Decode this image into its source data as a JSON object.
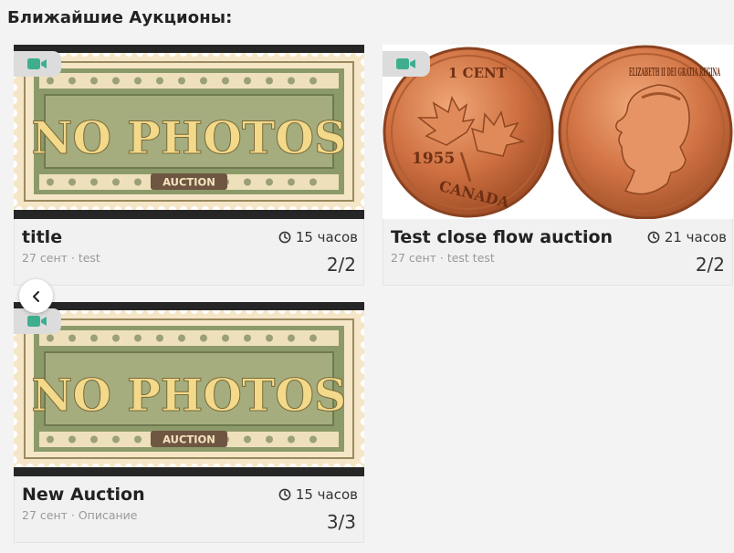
{
  "section": {
    "title": "Ближайшие Аукционы:"
  },
  "colors": {
    "camera_icon": "#3fae8f",
    "badge_bg": "#dcdcdc",
    "stamp_bg": "#8c9a6a",
    "stamp_text": "#f3d98a",
    "coin": "#c86a3c"
  },
  "placeholder": {
    "main_text": "NO PHOTOS",
    "ribbon_text": "AUCTION"
  },
  "coins": {
    "reverse_denomination": "1 CENT",
    "reverse_year": "1955",
    "reverse_country": "CANADA",
    "obverse_legend": "ELIZABETH II DEI GRATIA REGINA"
  },
  "auctions": [
    {
      "title": "title",
      "time": "15 часов",
      "meta": "27 сент · test",
      "count": "2/2",
      "icon": "video-camera-icon",
      "image": "no-photos-stamp"
    },
    {
      "title": "Test close flow auction",
      "time": "21 часов",
      "meta": "27 сент · test test",
      "count": "2/2",
      "icon": "video-camera-icon",
      "image": "canada-cent-coin"
    },
    {
      "title": "New Auction",
      "time": "15 часов",
      "meta": "27 сент · Описание",
      "count": "3/3",
      "icon": "video-camera-icon",
      "image": "no-photos-stamp"
    }
  ],
  "navigation": {
    "back_icon": "chevron-left-icon"
  }
}
